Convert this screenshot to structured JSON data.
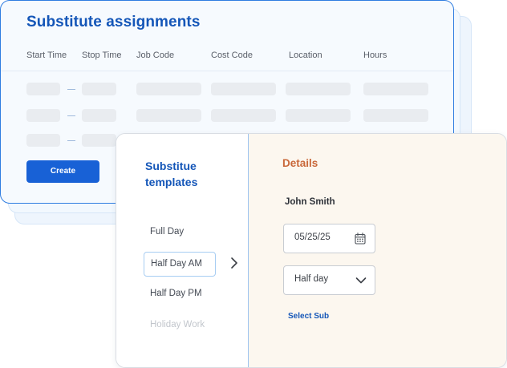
{
  "assignments": {
    "title": "Substitute assignments",
    "columns": [
      "Start Time",
      "Stop Time",
      "Job Code",
      "Cost Code",
      "Location",
      "Hours"
    ],
    "row_count": 3,
    "create_label": "Create"
  },
  "templates": {
    "title": "Substitue templates",
    "items": [
      {
        "label": "Full Day",
        "state": "normal"
      },
      {
        "label": "Half Day AM",
        "state": "selected"
      },
      {
        "label": "Half Day PM",
        "state": "normal"
      },
      {
        "label": "Holiday Work",
        "state": "faded"
      }
    ]
  },
  "details": {
    "title": "Details",
    "name": "John Smith",
    "date_value": "05/25/25",
    "duration_value": "Half day",
    "select_sub_label": "Select Sub"
  },
  "icons": {
    "date_icon": "calendar-icon",
    "select_icon": "chevron-down-icon",
    "arrow_icon": "chevron-right-icon"
  },
  "colors": {
    "brand_blue": "#1456b8",
    "button_blue": "#1861d6",
    "details_accent": "#c9683a",
    "details_background": "#fcf7ef",
    "skeleton": "#e9ecf0"
  }
}
